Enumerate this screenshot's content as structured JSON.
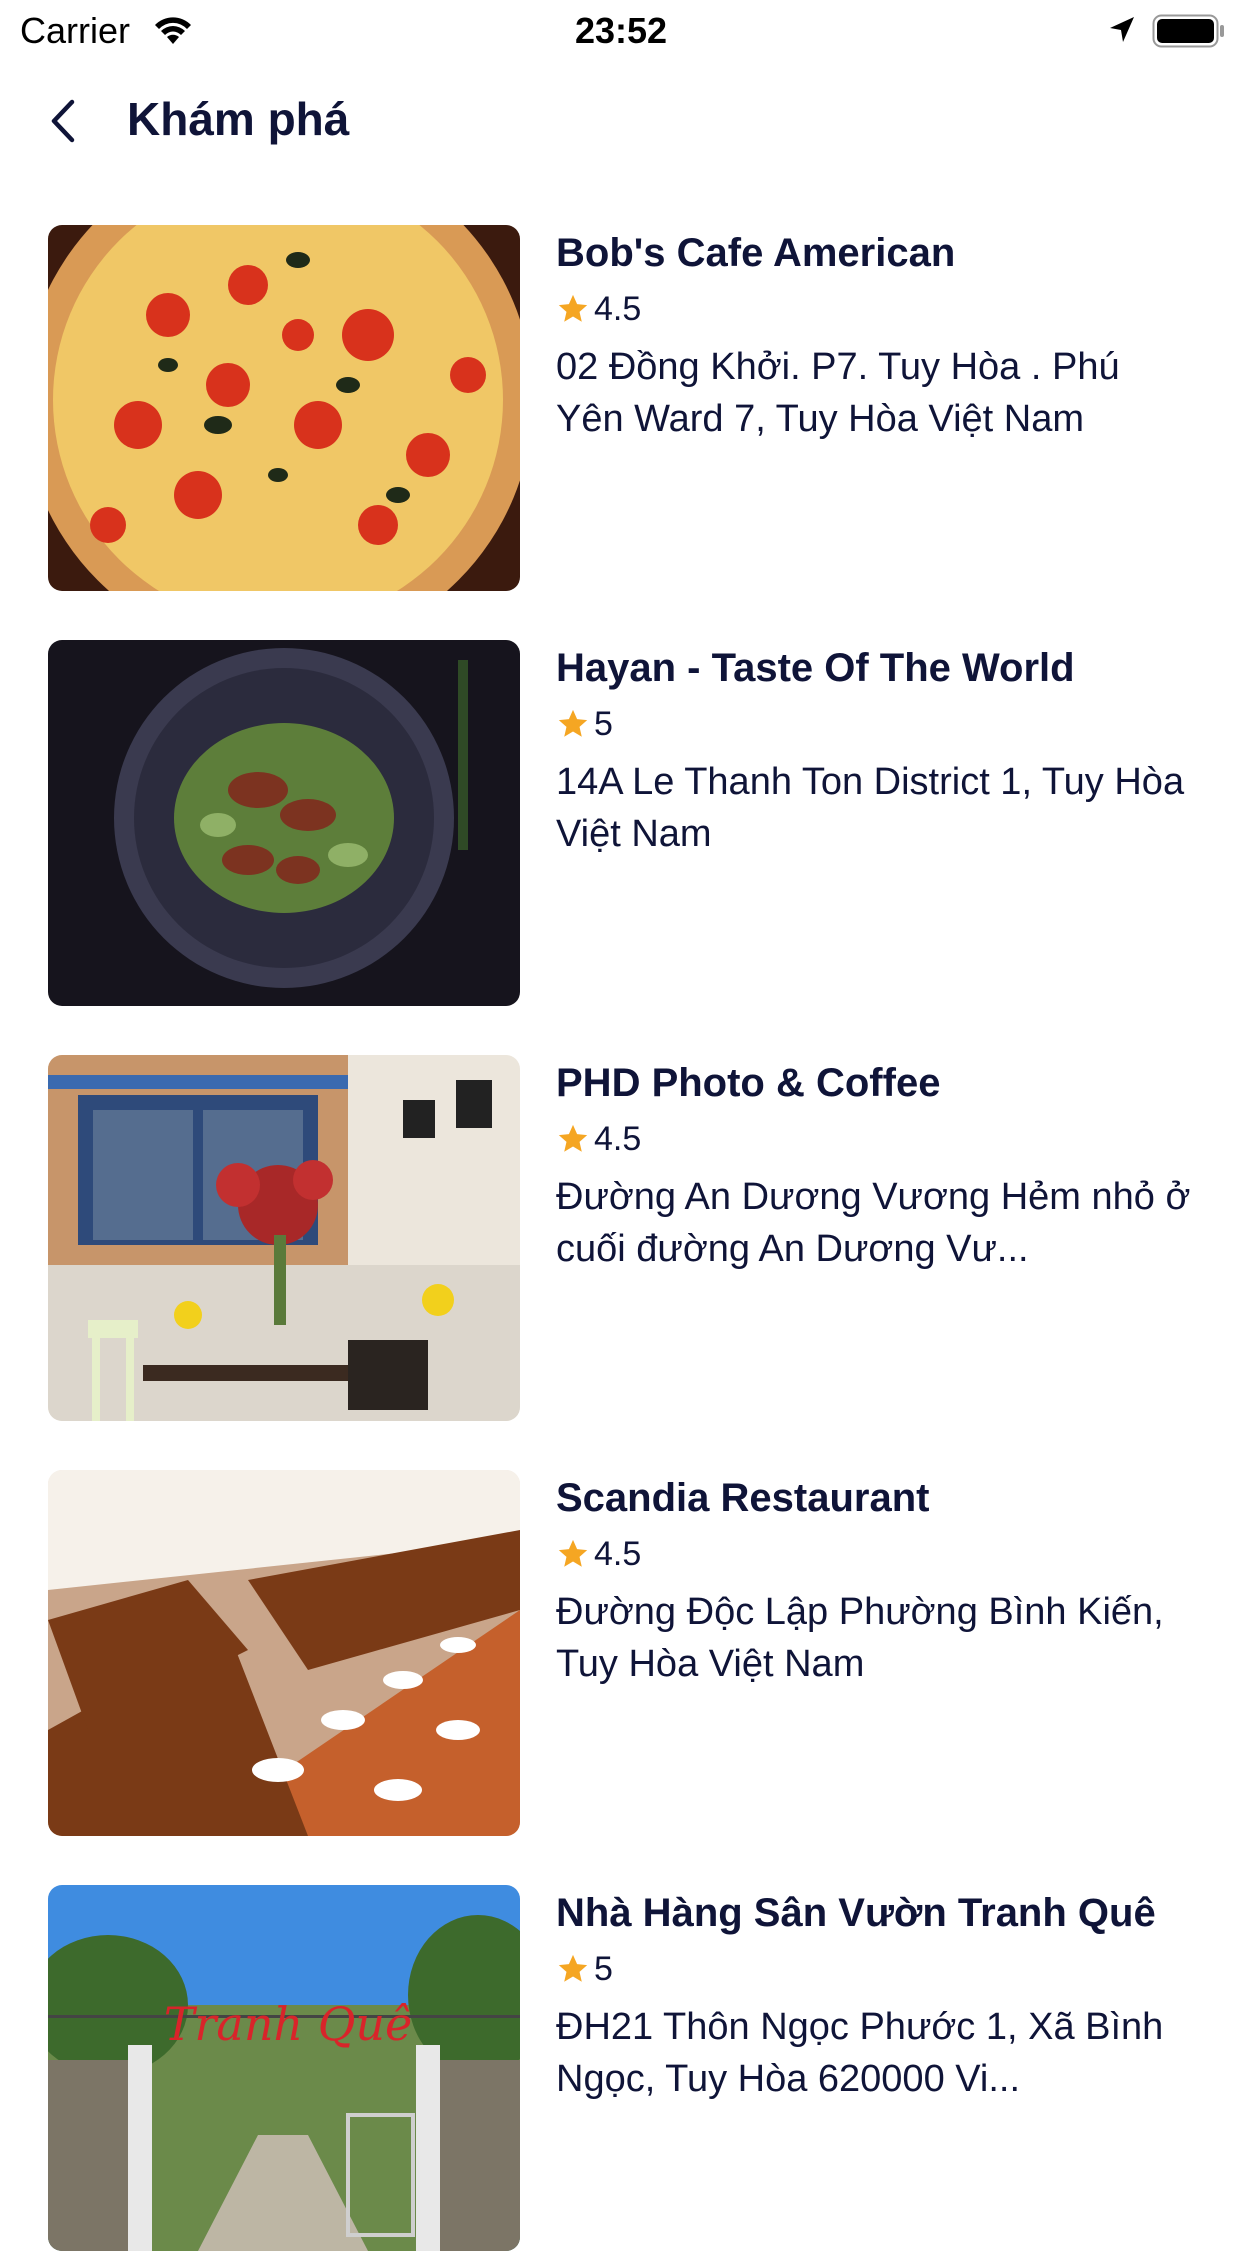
{
  "status_bar": {
    "carrier": "Carrier",
    "time": "23:52"
  },
  "nav": {
    "title": "Khám phá"
  },
  "icons": {
    "back": "chevron-left-icon",
    "star": "star-icon",
    "wifi": "wifi-icon",
    "location": "location-arrow-icon",
    "battery": "battery-icon"
  },
  "colors": {
    "title": "#0f1438",
    "star": "#f5a623"
  },
  "places": [
    {
      "name": "Bob's Cafe American",
      "rating": "4.5",
      "address": "02 Đồng Khởi. P7. Tuy Hòa . Phú Yên Ward 7, Tuy Hòa Việt Nam"
    },
    {
      "name": "Hayan - Taste Of The World",
      "rating": "5",
      "address": "14A Le Thanh Ton District 1, Tuy Hòa Việt Nam"
    },
    {
      "name": "PHD Photo & Coffee",
      "rating": "4.5",
      "address": "Đường An Dương Vương Hẻm nhỏ ở cuối đường An Dương Vư..."
    },
    {
      "name": "Scandia Restaurant",
      "rating": "4.5",
      "address": "Đường Độc Lập Phường Bình Kiến, Tuy Hòa Việt Nam"
    },
    {
      "name": "Nhà Hàng Sân Vườn Tranh Quê",
      "rating": "5",
      "address": "ĐH21 Thôn Ngọc Phước 1, Xã Bình Ngọc, Tuy Hòa 620000 Vi..."
    }
  ],
  "images": {
    "sign_text": "Tranh Quê"
  }
}
